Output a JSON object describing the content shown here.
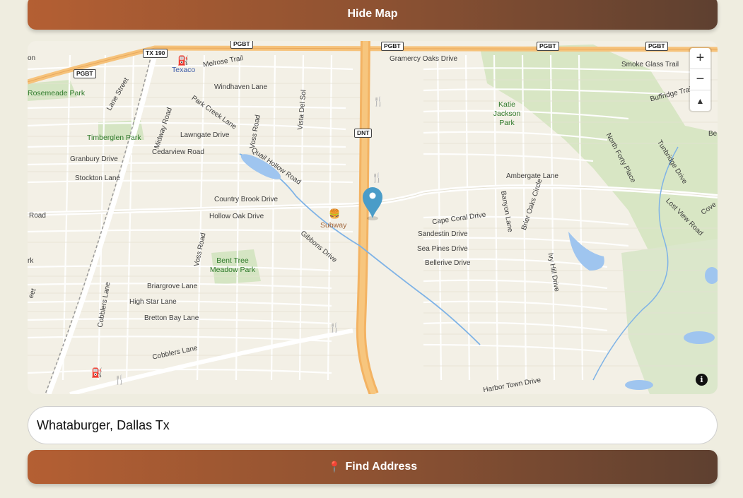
{
  "buttons": {
    "hide_map": "Hide Map",
    "find_address": "Find Address",
    "find_icon": "📍"
  },
  "search": {
    "value": "Whataburger, Dallas Tx",
    "placeholder": ""
  },
  "map": {
    "controls": {
      "zoom_in": "+",
      "zoom_out": "−",
      "reset": "▲"
    },
    "info": "i",
    "shields": [
      "PGBT",
      "PGBT",
      "PGBT",
      "PGBT",
      "PGBT",
      "TX 190",
      "DNT"
    ],
    "pois": {
      "subway": "Subway",
      "texaco": "Texaco"
    },
    "parks": {
      "rosemeade": "Rosemeade Park",
      "timberglen": "Timberglen Park",
      "katie": "Katie Jackson Park",
      "bent_tree": "Bent Tree Meadow Park"
    },
    "streets": {
      "gramercy": "Gramercy Oaks Drive",
      "smoke_glass": "Smoke Glass Trail",
      "buffridge": "Buffridge Trail",
      "melrose": "Melrose Trail",
      "windhaven": "Windhaven Lane",
      "lane_street": "Lane Street",
      "park_creek": "Park Creek Lane",
      "vista_del": "Vista Del Sol",
      "lawngate": "Lawngate Drive",
      "voss_top": "Voss Road",
      "midway": "Midway Road",
      "cedarview": "Cedarview Road",
      "granbury": "Granbury Drive",
      "stockton": "Stockton Lane",
      "quail_hollow": "Quail Hollow Road",
      "north_forty": "North Forty Place",
      "tunbridge": "Tunbridge Drive",
      "ambergate": "Ambergate Lane",
      "country_brook": "Country Brook Drive",
      "hollow_oak": "Hollow Oak Drive",
      "road_left": "Road",
      "cape_coral": "Cape Coral Drive",
      "banyon": "Banyon Lane",
      "brier_oaks": "Brier Oaks Circle",
      "lost_view": "Lost View Road",
      "sandestin": "Sandestin Drive",
      "sea_pines": "Sea Pines Drive",
      "bellerive": "Bellerive Drive",
      "gibbons": "Gibbons Drive",
      "voss_mid": "Voss Road",
      "ivy_hill": "Ivy Hill Drive",
      "briargrove": "Briargrove Lane",
      "high_star": "High Star Lane",
      "cobblers_v": "Cobblers Lane",
      "bretton_bay": "Bretton Bay Lane",
      "cobblers": "Cobblers Lane",
      "harbor_town": "Harbor Town Drive",
      "rk": "rk",
      "eet": "eet",
      "on": "on",
      "be": "Be",
      "cove": "Cove"
    }
  }
}
